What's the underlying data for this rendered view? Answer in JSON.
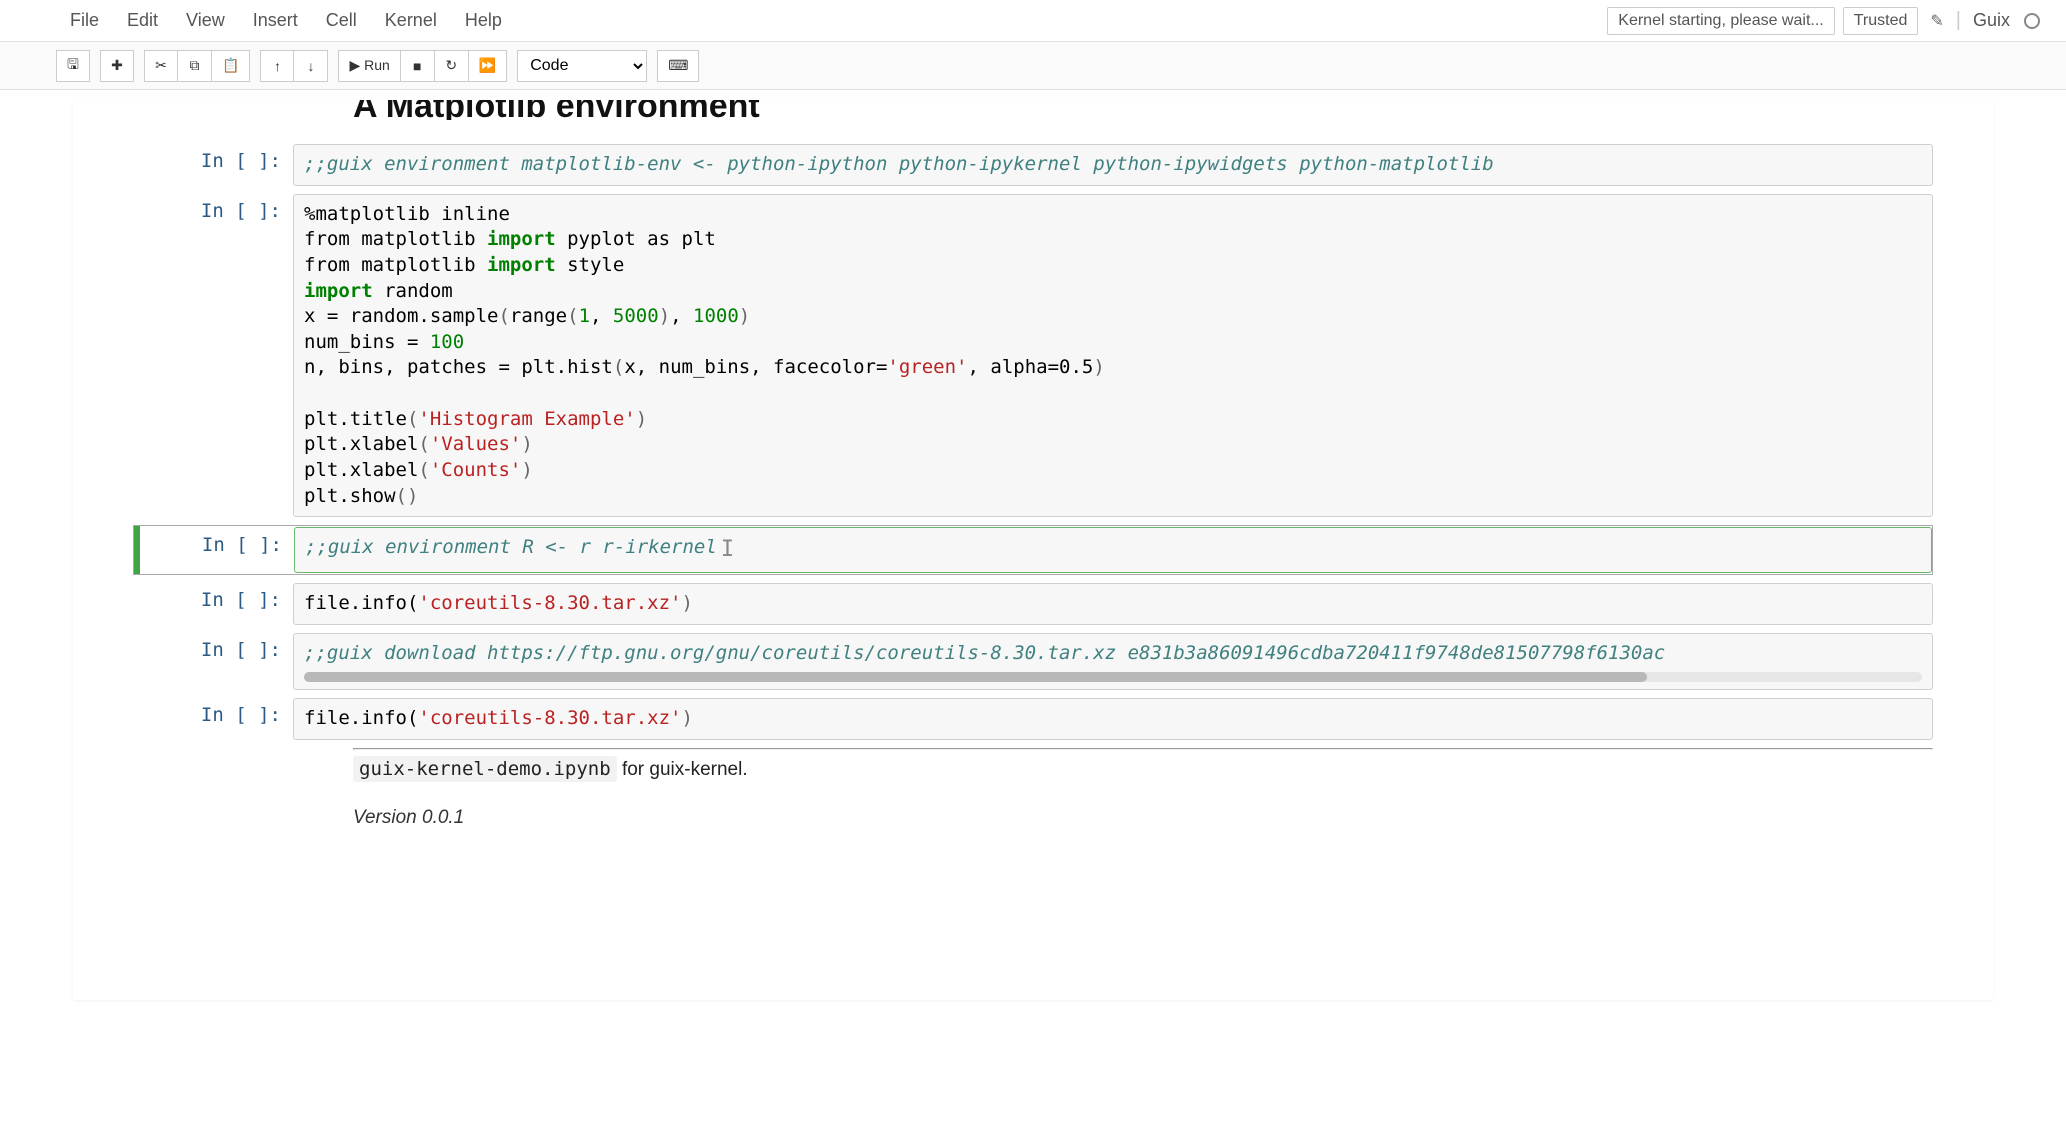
{
  "menu": {
    "items": [
      "File",
      "Edit",
      "View",
      "Insert",
      "Cell",
      "Kernel",
      "Help"
    ],
    "kernel_status": "Kernel starting, please wait...",
    "trusted": "Trusted",
    "kernel_name": "Guix"
  },
  "toolbar": {
    "run_label": "▶ Run",
    "celltype": "Code"
  },
  "heading_cut": "A Matplotlib environment",
  "cells": [
    {
      "prompt": "In [ ]:",
      "kind": "comment-line",
      "content": ";;guix environment matplotlib-env <- python-ipython python-ipykernel python-ipywidgets python-matplotlib"
    },
    {
      "prompt": "In [ ]:",
      "kind": "python-block",
      "lines": [
        {
          "t": "plain",
          "txt": "%matplotlib inline"
        },
        {
          "t": "import-as",
          "pre": "from matplotlib ",
          "kw": "import",
          "post": " pyplot as plt"
        },
        {
          "t": "import-as",
          "pre": "from matplotlib ",
          "kw": "import",
          "post": " style"
        },
        {
          "t": "import-only",
          "kw": "import",
          "post": " random"
        },
        {
          "t": "assign",
          "txt": "x = random.sample(range(1, 5000), 1000)",
          "nums": [
            "1",
            "5000",
            "1000"
          ]
        },
        {
          "t": "assign",
          "txt": "num_bins = 100",
          "nums": [
            "100"
          ]
        },
        {
          "t": "hist",
          "txt": "n, bins, patches = plt.hist(x, num_bins, facecolor='green', alpha=0.5)"
        },
        {
          "t": "blank"
        },
        {
          "t": "call-str",
          "pre": "plt.title(",
          "str": "'Histogram Example'",
          "post": ")"
        },
        {
          "t": "call-str",
          "pre": "plt.xlabel(",
          "str": "'Values'",
          "post": ")"
        },
        {
          "t": "call-str",
          "pre": "plt.xlabel(",
          "str": "'Counts'",
          "post": ")"
        },
        {
          "t": "call",
          "txt": "plt.show()"
        }
      ]
    },
    {
      "prompt": "In [ ]:",
      "kind": "comment-line-selected",
      "content": ";;guix environment R <- r r-irkernel"
    },
    {
      "prompt": "In [ ]:",
      "kind": "call-str-line",
      "pre": "file.info(",
      "str": "'coreutils-8.30.tar.xz'",
      "post": ")"
    },
    {
      "prompt": "In [ ]:",
      "kind": "comment-scroll",
      "content": ";;guix download https://ftp.gnu.org/gnu/coreutils/coreutils-8.30.tar.xz e831b3a86091496cdba720411f9748de81507798f6130ac"
    },
    {
      "prompt": "In [ ]:",
      "kind": "call-str-line",
      "pre": "file.info(",
      "str": "'coreutils-8.30.tar.xz'",
      "post": ")"
    }
  ],
  "footer": {
    "code": "guix-kernel-demo.ipynb",
    "text": " for guix-kernel.",
    "version": "Version 0.0.1"
  }
}
